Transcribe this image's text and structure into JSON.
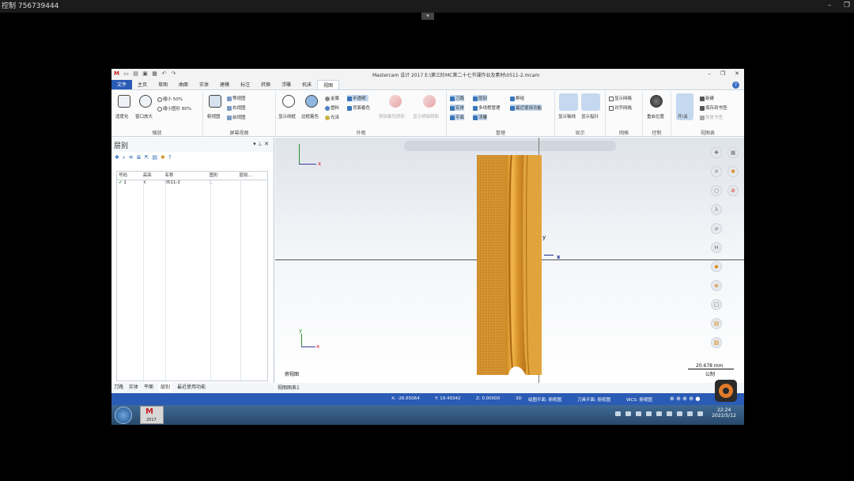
{
  "outer": {
    "title": "控制 756739444",
    "minimize": "–",
    "restore": "❐"
  },
  "app": {
    "title": "Mastercam 设计 2017  E:\\第三阶MC第二十七节课作业及素材\\0511-2.mcam",
    "window_controls": [
      "–",
      "❐",
      "✕"
    ]
  },
  "tabs": [
    "文件",
    "主页",
    "草图",
    "曲面",
    "实体",
    "建模",
    "标注",
    "转换",
    "浮雕",
    "机床",
    "视图"
  ],
  "ribbon": {
    "zoom": {
      "fit": "适度化",
      "window": "窗口放大",
      "shrink50": "缩小 50%",
      "shrink80": "缩小图形 80%",
      "label": "缩放"
    },
    "screen_view": {
      "top": "俯视图",
      "iso": "等视图",
      "right": "右视图",
      "front": "前视图",
      "label": "屏幕视图"
    },
    "appearance": {
      "wire": "显示线框",
      "edge": "边框着色",
      "metal": "金属",
      "plastic": "塑料",
      "gloss": "光泽",
      "translucent": "半透明",
      "backface": "背面着色",
      "label": "外观",
      "hidden_a": "移除着色阴影",
      "hidden_b": "显示移除阴影"
    },
    "manage": {
      "toolpath": "刀路",
      "solid": "实体",
      "plane": "平面",
      "levels": "层别",
      "multi": "多线程管理",
      "float": "浮雕",
      "recent": "最近使用功能",
      "group": "群组",
      "label": "管理"
    },
    "display": {
      "axis": "显示轴线",
      "indicator": "显示指针",
      "label": "显示"
    },
    "grid": {
      "show": "显示网格",
      "snap": "对齐网格",
      "label": "网格"
    },
    "control": {
      "home": "重启位置",
      "label": "控制"
    },
    "viewsheet": {
      "toggle": "开/关",
      "new": "新建",
      "save": "保存到书签",
      "restore": "恢复书签",
      "label": "视图表"
    }
  },
  "levels_panel": {
    "title": "层别",
    "columns": [
      "号码",
      "高亮",
      "名称",
      "图形",
      "层别..."
    ],
    "rows": [
      {
        "number": "1",
        "highlight": "X",
        "name": "0511-2",
        "count": "1"
      }
    ],
    "bottom_tabs": [
      "刀路",
      "实体",
      "平面",
      "层别",
      "最近使用功能"
    ]
  },
  "viewport": {
    "view_name": "俯视图",
    "scale_value": "20.678 mm",
    "scale_unit": "公制",
    "axis_x": "x",
    "axis_y": "y",
    "tab": "视图图表1",
    "part_color": "#d9952a"
  },
  "status": {
    "x": "X:   -26.65064",
    "y": "Y:   19.49342",
    "z": "Z:   0.00000",
    "mode": "3D",
    "plane": "绘图平面: 俯视图",
    "tool_plane": "刀具平面: 俯视图",
    "wcs": "WCS: 俯视图"
  },
  "taskbar": {
    "app": "2017",
    "time": "22:24",
    "date": "2022/5/12"
  }
}
